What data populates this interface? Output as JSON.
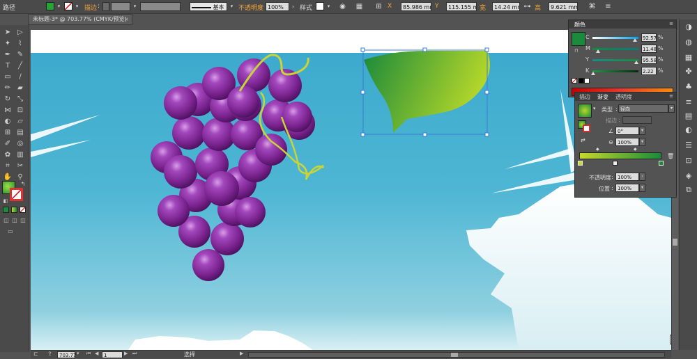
{
  "control_bar": {
    "mode_label": "路径",
    "stroke_label": "描边",
    "stroke_style": "基本",
    "opacity_label": "不透明度",
    "opacity_value": "100%",
    "style_label": "样式",
    "x_label": "X",
    "x_value": "85.986 mm",
    "y_label": "Y",
    "y_value": "115.155 mm",
    "w_label": "宽",
    "w_value": "14.24 mm",
    "h_label": "高",
    "h_value": "9.621 mm"
  },
  "document_tab": {
    "title": "未标题-3* @ 703.77% (CMYK/预览)",
    "close": "×"
  },
  "status_bar": {
    "zoom": "703.77",
    "artboard": "1",
    "mode": "选择"
  },
  "color_panel": {
    "title": "颜色",
    "sliders": [
      {
        "label": "C",
        "value": "92.57",
        "level": 0.9257,
        "gradient": "linear-gradient(90deg,#fff,#00a0e9)"
      },
      {
        "label": "M",
        "value": "11.48",
        "level": 0.1148,
        "gradient": "linear-gradient(90deg,#0e8d3e,#0a7a80)"
      },
      {
        "label": "Y",
        "value": "95.58",
        "level": 0.9558,
        "gradient": "linear-gradient(90deg,#168d8a,#1b8d3a)"
      },
      {
        "label": "K",
        "value": "2.22",
        "level": 0.0222,
        "gradient": "linear-gradient(90deg,#1a9a44,#062a10)"
      }
    ],
    "fill_color": "#1a8a3c"
  },
  "gradient_panel": {
    "tabs": [
      "描边",
      "渐变",
      "透明度"
    ],
    "type_label": "类型",
    "type_value": "径向",
    "stroke_label": "描边",
    "angle_value": "0°",
    "aspect_value": "100%",
    "opacity_label": "不透明度",
    "opacity_value": "100%",
    "position_label": "位置",
    "position_value": "100%",
    "stop_start_color": "#c6d92a",
    "stop_end_color": "#1b8a3a"
  }
}
